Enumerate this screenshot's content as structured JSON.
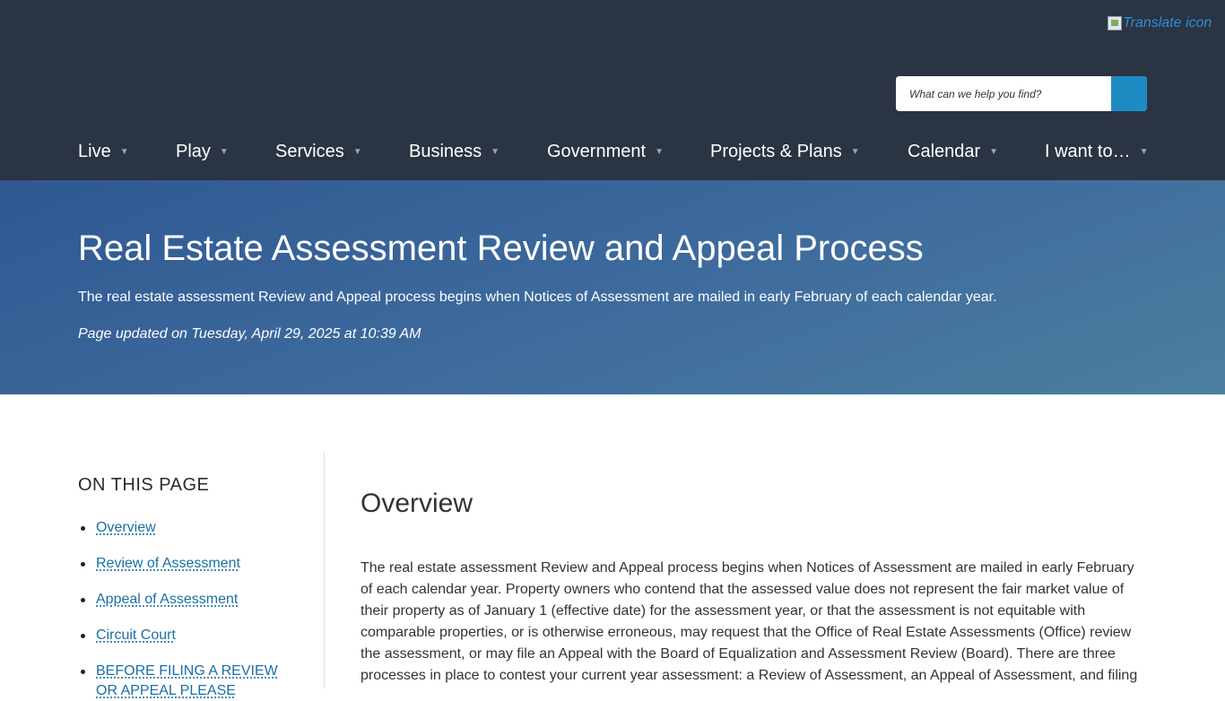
{
  "header": {
    "translate_label": "Translate icon",
    "search_placeholder": "What can we help you find?",
    "colors": {
      "background": "#2b3442",
      "search_button": "#1e8bc3"
    }
  },
  "nav": {
    "items": [
      {
        "label": "Live"
      },
      {
        "label": "Play"
      },
      {
        "label": "Services"
      },
      {
        "label": "Business"
      },
      {
        "label": "Government"
      },
      {
        "label": "Projects & Plans"
      },
      {
        "label": "Calendar"
      },
      {
        "label": "I want to…"
      }
    ],
    "caret": "▼"
  },
  "hero": {
    "title": "Real Estate Assessment Review and Appeal Process",
    "intro": "The real estate assessment Review and Appeal process begins when Notices of Assessment are mailed in early February of each calendar year.",
    "updated": "Page updated on Tuesday, April 29, 2025 at 10:39 AM"
  },
  "toc": {
    "title": "ON THIS PAGE",
    "items": [
      {
        "label": "Overview"
      },
      {
        "label": "Review of Assessment"
      },
      {
        "label": "Appeal of Assessment"
      },
      {
        "label": "Circuit Court"
      },
      {
        "label": "BEFORE FILING A REVIEW OR APPEAL PLEASE"
      }
    ]
  },
  "main": {
    "heading": "Overview",
    "body": "The real estate assessment Review and Appeal process begins when Notices of Assessment are mailed in early February of each calendar year. Property owners who contend that the assessed value does not represent the fair market value of their property as of January 1 (effective date) for the assessment year, or that the assessment is not equitable with comparable properties, or is otherwise erroneous, may request that the Office of Real Estate Assessments (Office) review the assessment, or may file an Appeal with the Board of Equalization and Assessment Review (Board).  There are three processes in place to contest your current year assessment: a Review of Assessment, an Appeal of Assessment, and filing"
  }
}
